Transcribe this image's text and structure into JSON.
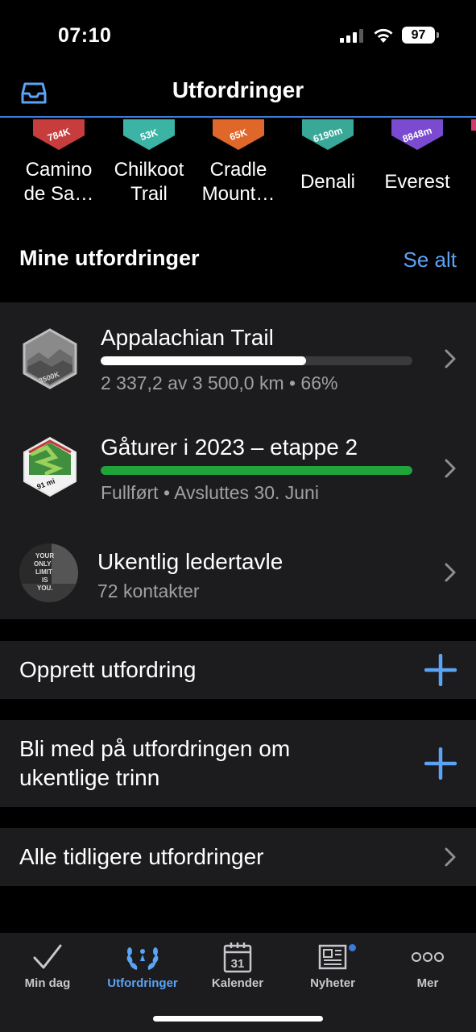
{
  "status": {
    "time": "07:10",
    "battery": "97"
  },
  "nav": {
    "title": "Utfordringer"
  },
  "badges": [
    {
      "name": "Camino de Sa…",
      "label": "784K",
      "color": "#c73d3d"
    },
    {
      "name": "Chilkoot Trail",
      "label": "53K",
      "color": "#3bb3a5"
    },
    {
      "name": "Cradle Mount…",
      "label": "65K",
      "color": "#e0672a"
    },
    {
      "name": "Denali",
      "label": "6190m",
      "color": "#3aa898"
    },
    {
      "name": "Everest",
      "label": "8848m",
      "color": "#7a4ad0"
    }
  ],
  "section": {
    "title": "Mine utfordringer",
    "see_all": "Se alt"
  },
  "my_challenges": [
    {
      "title": "Appalachian Trail",
      "sub": "2 337,2 av 3 500,0 km • 66%",
      "progress": 0.66,
      "bar_color": "#ffffff",
      "badge_text": "3500K"
    },
    {
      "title": "Gåturer i 2023 – etappe 2",
      "sub": "Fullført • Avsluttes 30. Juni",
      "progress": 1.0,
      "bar_color": "#1fa33a",
      "badge_text": "91 mi"
    },
    {
      "title": "Ukentlig ledertavle",
      "sub": "72 kontakter",
      "avatar_text": "YOUR ONLY LIMIT IS YOU."
    }
  ],
  "actions": {
    "create": "Opprett utfordring",
    "join": "Bli med på utfordringen om ukentlige trinn",
    "past": "Alle tidligere utfordringer"
  },
  "tabs": [
    {
      "label": "Min dag",
      "icon": "check-icon"
    },
    {
      "label": "Utfordringer",
      "icon": "laurel-icon"
    },
    {
      "label": "Kalender",
      "icon": "calendar-icon",
      "day": "31"
    },
    {
      "label": "Nyheter",
      "icon": "newspaper-icon"
    },
    {
      "label": "Mer",
      "icon": "more-icon"
    }
  ],
  "colors": {
    "accent": "#5ba3f5",
    "background": "#000000",
    "card": "#1c1c1e"
  }
}
